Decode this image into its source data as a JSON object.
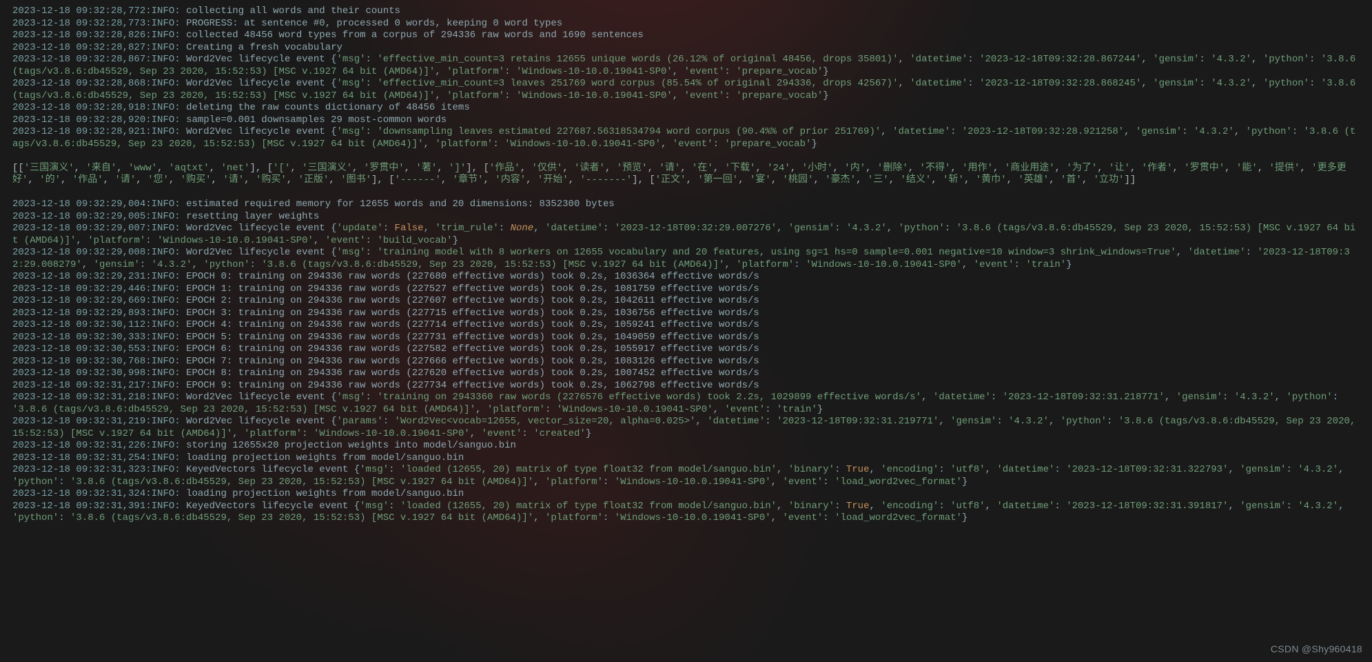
{
  "watermark": "CSDN @Shy960418",
  "env": {
    "gensim": "4.3.2",
    "python": "3.8.6 (tags/v3.8.6:db45529, Sep 23 2020, 15:52:53) [MSC v.1927 64 bit (AMD64)]",
    "platform": "Windows-10-10.0.19041-SP0"
  },
  "lines": [
    {
      "t": "log",
      "ts": "2023-12-18 09:32:28,772",
      "lvl": "INFO",
      "msg": "collecting all words and their counts"
    },
    {
      "t": "log",
      "ts": "2023-12-18 09:32:28,773",
      "lvl": "INFO",
      "msg": "PROGRESS: at sentence #0, processed 0 words, keeping 0 word types"
    },
    {
      "t": "log",
      "ts": "2023-12-18 09:32:28,826",
      "lvl": "INFO",
      "msg": "collected 48456 word types from a corpus of 294336 raw words and 1690 sentences"
    },
    {
      "t": "log",
      "ts": "2023-12-18 09:32:28,827",
      "lvl": "INFO",
      "msg": "Creating a fresh vocabulary"
    },
    {
      "t": "lifecycle",
      "ts": "2023-12-18 09:32:28,867",
      "lvl": "INFO",
      "name": "Word2Vec",
      "dict": {
        "msg": "effective_min_count=3 retains 12655 unique words (26.12% of original 48456, drops 35801)",
        "datetime": "2023-12-18T09:32:28.867244",
        "event": "prepare_vocab"
      }
    },
    {
      "t": "lifecycle",
      "ts": "2023-12-18 09:32:28,868",
      "lvl": "INFO",
      "name": "Word2Vec",
      "dict": {
        "msg": "effective_min_count=3 leaves 251769 word corpus (85.54% of original 294336, drops 42567)",
        "datetime": "2023-12-18T09:32:28.868245",
        "event": "prepare_vocab"
      }
    },
    {
      "t": "log",
      "ts": "2023-12-18 09:32:28,918",
      "lvl": "INFO",
      "msg": "deleting the raw counts dictionary of 48456 items"
    },
    {
      "t": "log",
      "ts": "2023-12-18 09:32:28,920",
      "lvl": "INFO",
      "msg": "sample=0.001 downsamples 29 most-common words"
    },
    {
      "t": "lifecycle",
      "ts": "2023-12-18 09:32:28,921",
      "lvl": "INFO",
      "name": "Word2Vec",
      "dict": {
        "msg": "downsampling leaves estimated 227687.56318534794 word corpus (90.4%% of prior 251769)",
        "datetime": "2023-12-18T09:32:28.921258",
        "event": "prepare_vocab"
      }
    },
    {
      "t": "blank"
    },
    {
      "t": "pyprint",
      "rows": [
        [
          "三国演义",
          "来自",
          "www",
          "aqtxt",
          "net"
        ],
        [
          "[",
          "三国演义",
          "罗贯中",
          "著",
          "]"
        ],
        [
          "作品",
          "仅供",
          "读者",
          "预览",
          "请",
          "在",
          "下载",
          "24",
          "小时",
          "内",
          "删除",
          "不得",
          "用作",
          "商业用途",
          "为了",
          "让",
          "作者",
          "罗贯中",
          "能",
          "提供",
          "更多更好",
          "的",
          "作品",
          "请",
          "您",
          "购买",
          "请",
          "购买",
          "正版",
          "图书"
        ],
        [
          "------",
          "章节",
          "内容",
          "开始",
          "-------"
        ],
        [
          "正文",
          "第一回",
          "宴",
          "桃园",
          "豪杰",
          "三",
          "结义",
          "斩",
          "黄巾",
          "英雄",
          "首",
          "立功"
        ]
      ]
    },
    {
      "t": "blank"
    },
    {
      "t": "log",
      "ts": "2023-12-18 09:32:29,004",
      "lvl": "INFO",
      "msg": "estimated required memory for 12655 words and 20 dimensions: 8352300 bytes"
    },
    {
      "t": "log",
      "ts": "2023-12-18 09:32:29,005",
      "lvl": "INFO",
      "msg": "resetting layer weights"
    },
    {
      "t": "lifecycle",
      "ts": "2023-12-18 09:32:29,007",
      "lvl": "INFO",
      "name": "Word2Vec",
      "dict": {
        "update": false,
        "trim_rule": null,
        "datetime": "2023-12-18T09:32:29.007276",
        "event": "build_vocab"
      }
    },
    {
      "t": "lifecycle",
      "ts": "2023-12-18 09:32:29,008",
      "lvl": "INFO",
      "name": "Word2Vec",
      "dict": {
        "msg": "training model with 8 workers on 12655 vocabulary and 20 features, using sg=1 hs=0 sample=0.001 negative=10 window=3 shrink_windows=True",
        "datetime": "2023-12-18T09:32:29.008279",
        "event": "train"
      }
    },
    {
      "t": "log",
      "ts": "2023-12-18 09:32:29,231",
      "lvl": "INFO",
      "msg": "EPOCH 0: training on 294336 raw words (227680 effective words) took 0.2s, 1036364 effective words/s"
    },
    {
      "t": "log",
      "ts": "2023-12-18 09:32:29,446",
      "lvl": "INFO",
      "msg": "EPOCH 1: training on 294336 raw words (227527 effective words) took 0.2s, 1081759 effective words/s"
    },
    {
      "t": "log",
      "ts": "2023-12-18 09:32:29,669",
      "lvl": "INFO",
      "msg": "EPOCH 2: training on 294336 raw words (227607 effective words) took 0.2s, 1042611 effective words/s"
    },
    {
      "t": "log",
      "ts": "2023-12-18 09:32:29,893",
      "lvl": "INFO",
      "msg": "EPOCH 3: training on 294336 raw words (227715 effective words) took 0.2s, 1036756 effective words/s"
    },
    {
      "t": "log",
      "ts": "2023-12-18 09:32:30,112",
      "lvl": "INFO",
      "msg": "EPOCH 4: training on 294336 raw words (227714 effective words) took 0.2s, 1059241 effective words/s"
    },
    {
      "t": "log",
      "ts": "2023-12-18 09:32:30,333",
      "lvl": "INFO",
      "msg": "EPOCH 5: training on 294336 raw words (227731 effective words) took 0.2s, 1049059 effective words/s"
    },
    {
      "t": "log",
      "ts": "2023-12-18 09:32:30,553",
      "lvl": "INFO",
      "msg": "EPOCH 6: training on 294336 raw words (227582 effective words) took 0.2s, 1055917 effective words/s"
    },
    {
      "t": "log",
      "ts": "2023-12-18 09:32:30,768",
      "lvl": "INFO",
      "msg": "EPOCH 7: training on 294336 raw words (227666 effective words) took 0.2s, 1083126 effective words/s"
    },
    {
      "t": "log",
      "ts": "2023-12-18 09:32:30,998",
      "lvl": "INFO",
      "msg": "EPOCH 8: training on 294336 raw words (227620 effective words) took 0.2s, 1007452 effective words/s"
    },
    {
      "t": "log",
      "ts": "2023-12-18 09:32:31,217",
      "lvl": "INFO",
      "msg": "EPOCH 9: training on 294336 raw words (227734 effective words) took 0.2s, 1062798 effective words/s"
    },
    {
      "t": "lifecycle",
      "ts": "2023-12-18 09:32:31,218",
      "lvl": "INFO",
      "name": "Word2Vec",
      "dict": {
        "msg": "training on 2943360 raw words (2276576 effective words) took 2.2s, 1029899 effective words/s",
        "datetime": "2023-12-18T09:32:31.218771",
        "event": "train"
      }
    },
    {
      "t": "lifecycle",
      "ts": "2023-12-18 09:32:31,219",
      "lvl": "INFO",
      "name": "Word2Vec",
      "dict": {
        "params": "Word2Vec<vocab=12655, vector_size=20, alpha=0.025>",
        "datetime": "2023-12-18T09:32:31.219771",
        "event": "created"
      }
    },
    {
      "t": "log",
      "ts": "2023-12-18 09:32:31,226",
      "lvl": "INFO",
      "msg": "storing 12655x20 projection weights into model/sanguo.bin"
    },
    {
      "t": "log",
      "ts": "2023-12-18 09:32:31,254",
      "lvl": "INFO",
      "msg": "loading projection weights from model/sanguo.bin"
    },
    {
      "t": "lifecycle",
      "ts": "2023-12-18 09:32:31,323",
      "lvl": "INFO",
      "name": "KeyedVectors",
      "dict": {
        "msg": "loaded (12655, 20) matrix of type float32 from model/sanguo.bin",
        "binary": true,
        "encoding": "utf8",
        "datetime": "2023-12-18T09:32:31.322793",
        "event": "load_word2vec_format"
      }
    },
    {
      "t": "log",
      "ts": "2023-12-18 09:32:31,324",
      "lvl": "INFO",
      "msg": "loading projection weights from model/sanguo.bin"
    },
    {
      "t": "lifecycle",
      "ts": "2023-12-18 09:32:31,391",
      "lvl": "INFO",
      "name": "KeyedVectors",
      "dict": {
        "msg": "loaded (12655, 20) matrix of type float32 from model/sanguo.bin",
        "binary": true,
        "encoding": "utf8",
        "datetime": "2023-12-18T09:32:31.391817",
        "event": "load_word2vec_format"
      }
    }
  ]
}
